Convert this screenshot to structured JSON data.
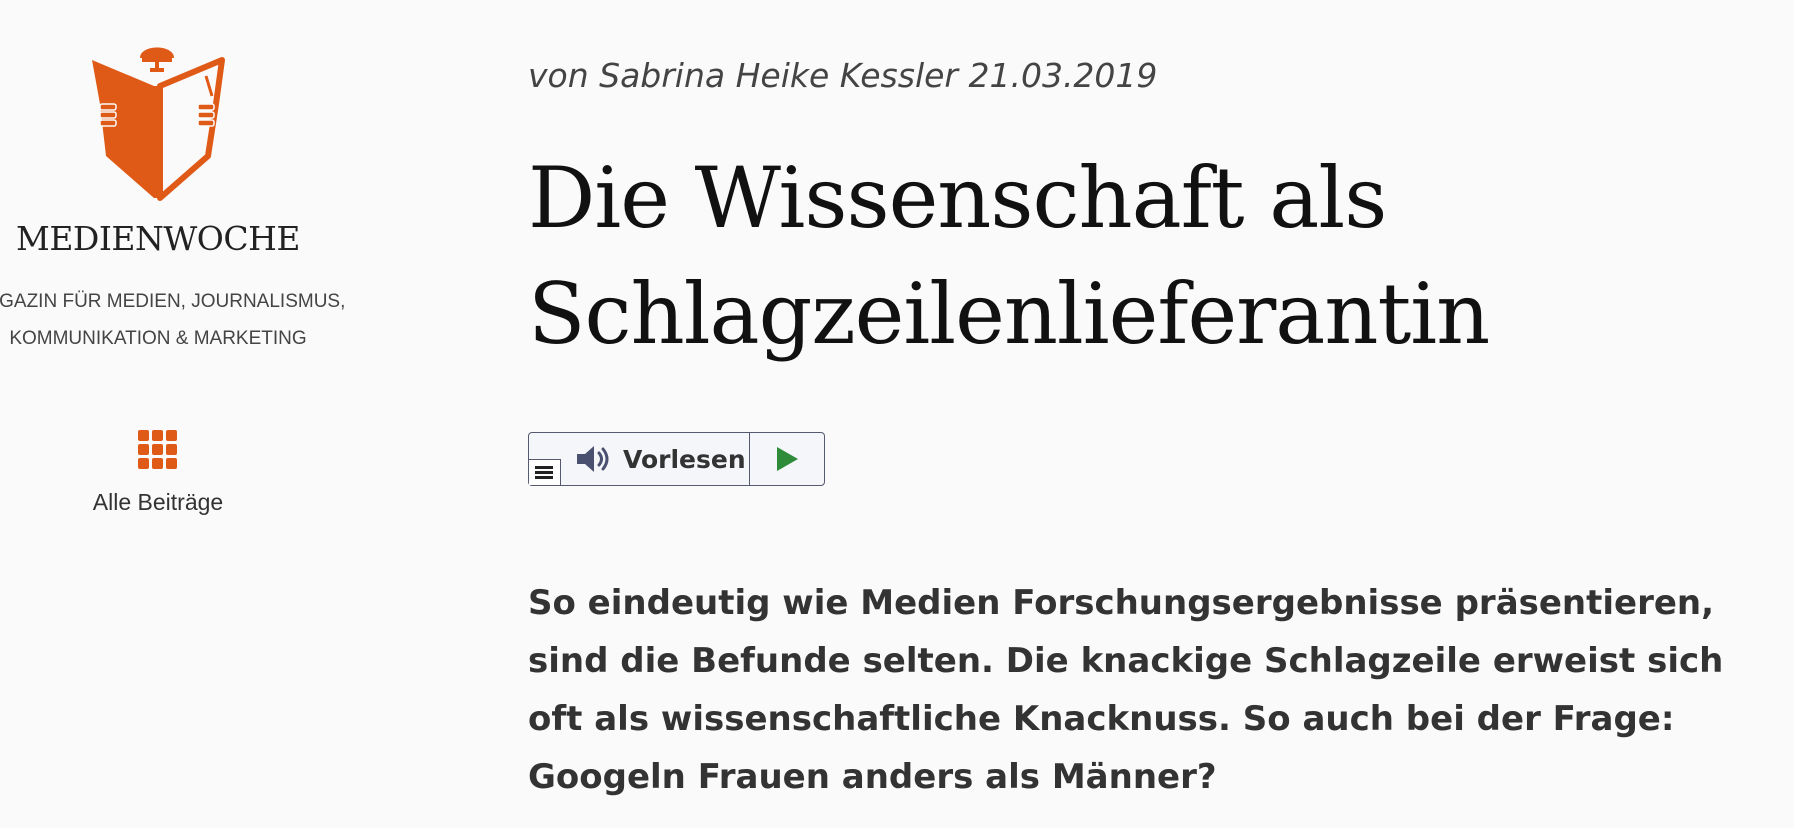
{
  "sidebar": {
    "brand_name": "MEDIENWOCHE",
    "tagline_line1": "MAGAZIN FÜR MEDIEN, JOURNALISMUS,",
    "tagline_line2": "KOMMUNIKATION & MARKETING",
    "all_posts_label": "Alle Beiträge",
    "all_posts_icon": "grid-icon",
    "logo_icon": "reader-with-newspaper-logo",
    "accent_color": "#e05a17"
  },
  "article": {
    "byline": "von Sabrina Heike Kessler 21.03.2019",
    "title": "Die Wissenschaft als Schlagzeilenlieferantin",
    "lead": "So eindeutig wie Medien Forschungsergebnisse präsentieren, sind die Befunde selten. Die knackige Schlagzeile erweist sich oft als wissenschaftliche Knacknuss. So auch bei der Frage: Googeln Frauen anders als Männer?"
  },
  "readspeaker": {
    "label": "Vorlesen",
    "menu_icon": "menu-icon",
    "speaker_icon": "speaker-icon",
    "play_icon": "play-icon",
    "play_color": "#2e8b3a"
  }
}
